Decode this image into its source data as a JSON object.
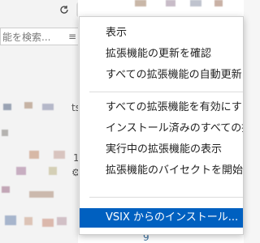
{
  "search": {
    "placeholder": "能を検索..."
  },
  "menu": {
    "items": [
      "表示",
      "拡張機能の更新を確認",
      "すべての拡張機能の自動更新",
      "すべての拡張機能を有効にす",
      "インストール済みのすべての拡張",
      "実行中の拡張機能の表示",
      "拡張機能のバイセクトを開始",
      "VSIX からのインストール..."
    ]
  },
  "side_snippets": {
    "ts": "ts",
    "gear": "⚙",
    "one": "1"
  },
  "bottom_num": "9",
  "colors": {
    "accent": "#0060c0",
    "menu_bg": "#ffffff",
    "pane_bg": "#f3f3f3"
  }
}
